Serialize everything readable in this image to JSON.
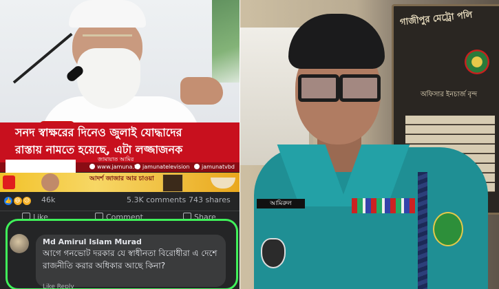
{
  "left_post": {
    "headline_line1": "সনদ স্বাক্ষরের দিনেও জুলাই যোদ্ধাদের",
    "headline_line2": "রাস্তায় নামতে হয়েছে, এটা লজ্জাজনক",
    "headline_attrib": "জামায়াত আমির",
    "sources": [
      "www.jamuna.tv",
      "jamunatelevision",
      "jamunatvbd"
    ],
    "ad_text": "আদর্শ জাজার আর চাওয়া",
    "reaction_count": "46k",
    "comments": "5.3K comments",
    "shares": "743 shares",
    "actions": [
      "Like",
      "Comment",
      "Share"
    ],
    "comment": {
      "author": "Md Amirul Islam Murad",
      "text": "আগে গনভোট দরকার যে স্বাধীনতা বিরোধীরা এ দেশে রাজনীতি করার অধিকার আছে কিনা?",
      "reply_row": "Like   Reply"
    },
    "colors": {
      "headline_red": "#c8101e",
      "highlight_green": "#40f25a",
      "fb_dark": "#242526"
    }
  },
  "right_photo": {
    "board_title": "গাজীপুর মেট্রো পলি",
    "board_sub": "অফিসার ইনচার্জ বৃন্দ",
    "name_tag": "আমিরুল",
    "colors": {
      "uniform": "#1f8f94"
    }
  }
}
